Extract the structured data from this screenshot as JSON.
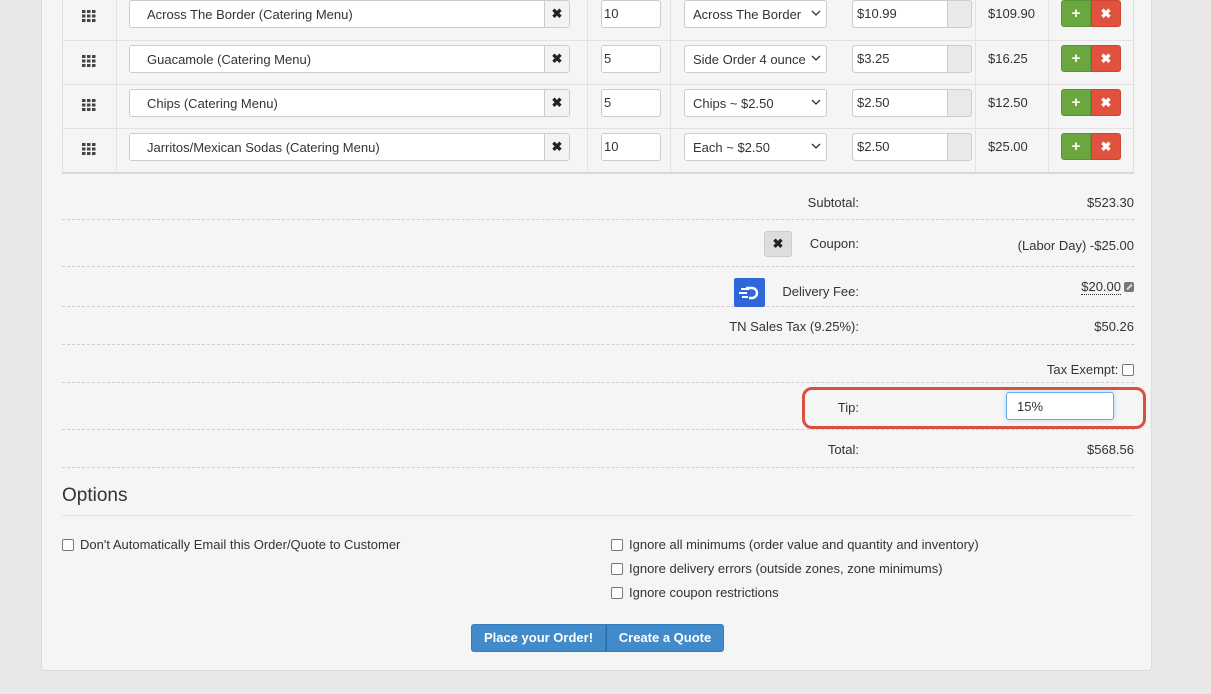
{
  "items": [
    {
      "name": "Across The Border (Catering Menu)",
      "qty": "10",
      "option": "Across The Border",
      "price": "$10.99",
      "total": "$109.90"
    },
    {
      "name": "Guacamole (Catering Menu)",
      "qty": "5",
      "option": "Side Order 4 ounce",
      "price": "$3.25",
      "total": "$16.25"
    },
    {
      "name": "Chips (Catering Menu)",
      "qty": "5",
      "option": "Chips ~ $2.50",
      "price": "$2.50",
      "total": "$12.50"
    },
    {
      "name": "Jarritos/Mexican Sodas (Catering Menu)",
      "qty": "10",
      "option": "Each ~ $2.50",
      "price": "$2.50",
      "total": "$25.00"
    }
  ],
  "summary": {
    "subtotal_label": "Subtotal:",
    "subtotal_value": "$523.30",
    "coupon_label": "Coupon:",
    "coupon_value": "(Labor Day) -$25.00",
    "delivery_label": "Delivery Fee:",
    "delivery_value": "$20.00",
    "tax_label": "TN Sales Tax (9.25%):",
    "tax_value": "$50.26",
    "tax_exempt_label": "Tax Exempt:",
    "tip_label": "Tip:",
    "tip_value": "15%",
    "total_label": "Total:",
    "total_value": "$568.56"
  },
  "options": {
    "title": "Options",
    "no_email": "Don't Automatically Email this Order/Quote to Customer",
    "ignore_minimums": "Ignore all minimums (order value and quantity and inventory)",
    "ignore_delivery": "Ignore delivery errors (outside zones, zone minimums)",
    "ignore_coupon": "Ignore coupon restrictions"
  },
  "buttons": {
    "place_order": "Place your Order!",
    "create_quote": "Create a Quote"
  },
  "colors": {
    "add": "#6aa83f",
    "remove": "#e0523e",
    "primary": "#428bca",
    "highlight": "#d9513e",
    "doordash": "#2f66d8"
  }
}
